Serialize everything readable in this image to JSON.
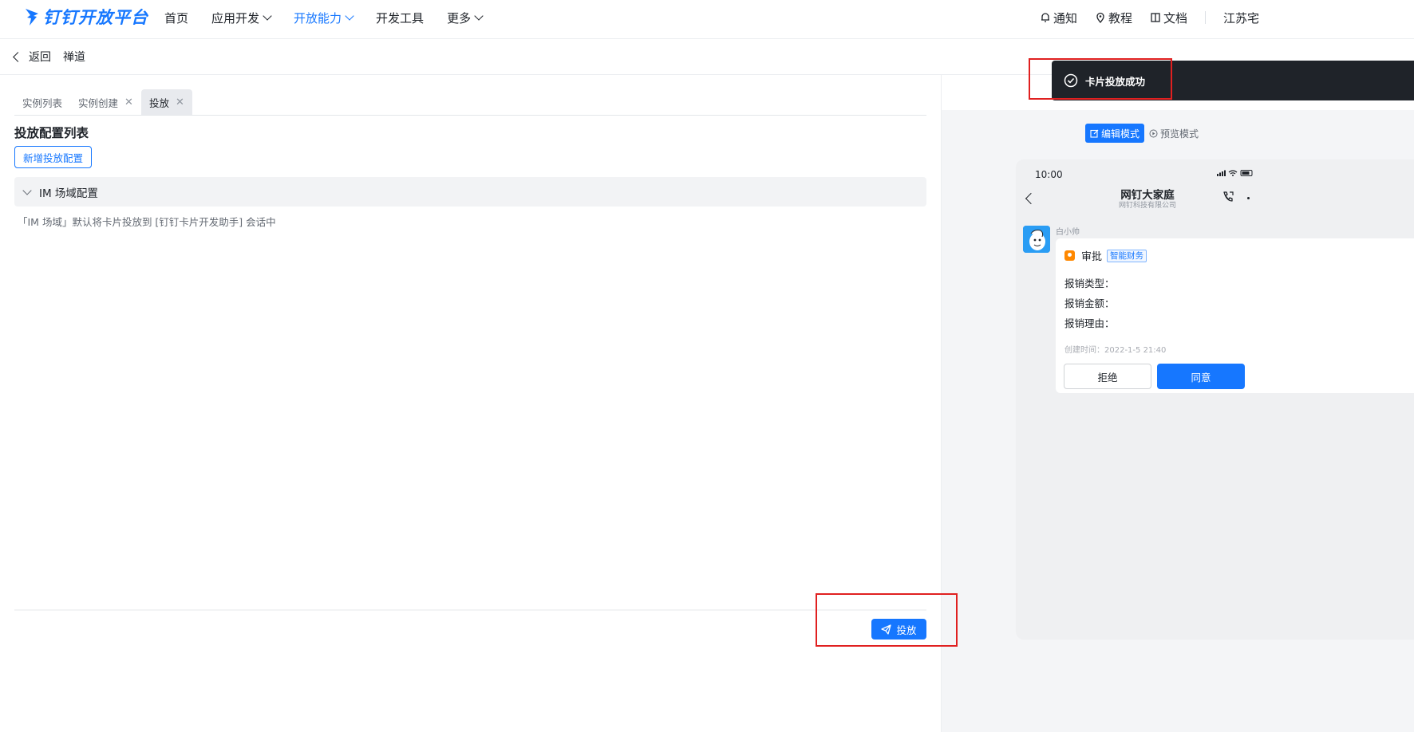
{
  "brand": {
    "name": "钉钉开放平台",
    "color": "#1677ff"
  },
  "nav": {
    "items": [
      {
        "label": "首页",
        "dropdown": false,
        "active": false
      },
      {
        "label": "应用开发",
        "dropdown": true,
        "active": false
      },
      {
        "label": "开放能力",
        "dropdown": true,
        "active": true
      },
      {
        "label": "开发工具",
        "dropdown": false,
        "active": false
      },
      {
        "label": "更多",
        "dropdown": true,
        "active": false
      }
    ],
    "right": {
      "notify": "通知",
      "tutorial": "教程",
      "docs": "文档",
      "org": "江苏宅"
    }
  },
  "breadcrumb": {
    "back": "返回",
    "title": "禅道"
  },
  "tabs": [
    {
      "label": "实例列表",
      "closable": false,
      "active": false
    },
    {
      "label": "实例创建",
      "closable": true,
      "active": false
    },
    {
      "label": "投放",
      "closable": true,
      "active": true
    }
  ],
  "section": {
    "title": "投放配置列表",
    "add_button": "新增投放配置",
    "collapse_label": "IM 场域配置",
    "description": "「IM 场域」默认将卡片投放到 [钉钉卡片开发助手] 会话中"
  },
  "send_button": "投放",
  "preview": {
    "edit_mode": "编辑模式",
    "preview_mode": "预览模式",
    "status_time": "10:00",
    "chat_title": "网钉大家庭",
    "chat_subtitle": "网钉科技有限公司",
    "sender": "白小帅",
    "card": {
      "app_name": "审批",
      "tag": "智能财务",
      "fields": [
        "报销类型：",
        "报销金额：",
        "报销理由："
      ],
      "created_time": "创建时间：2022-1-5 21:40",
      "reject": "拒绝",
      "agree": "同意"
    }
  },
  "toast": {
    "message": "卡片投放成功"
  },
  "colors": {
    "primary": "#1677ff",
    "toast_bg": "#1f2329",
    "highlight": "#e02020"
  }
}
